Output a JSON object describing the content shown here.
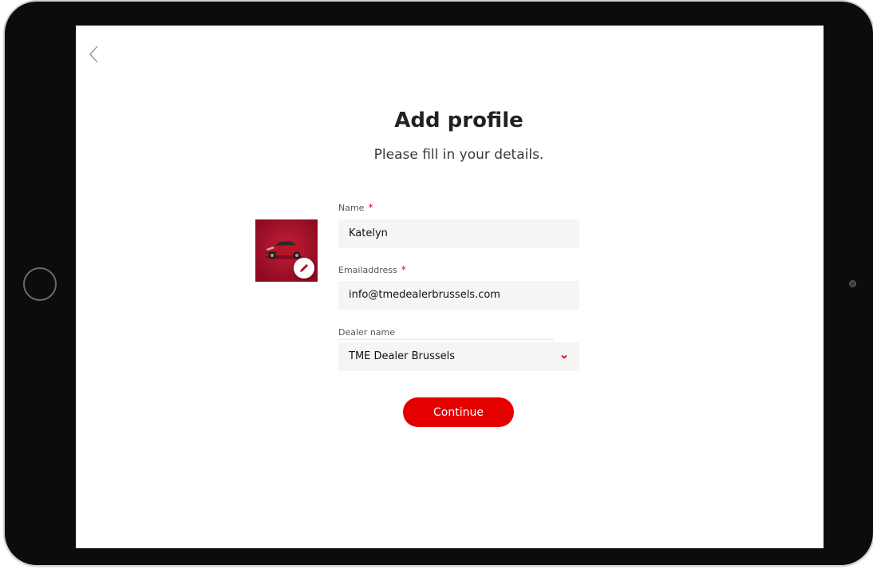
{
  "page": {
    "title": "Add profile",
    "subtitle": "Please fill in your details."
  },
  "form": {
    "name": {
      "label": "Name",
      "required_mark": "*",
      "value": "Katelyn"
    },
    "email": {
      "label": "Emailaddress",
      "required_mark": "*",
      "value": "info@tmedealerbrussels.com"
    },
    "dealer": {
      "label": "Dealer name",
      "selected": "TME Dealer Brussels"
    },
    "continue_label": "Continue"
  },
  "icons": {
    "back": "chevron-left-icon",
    "edit": "pencil-icon",
    "dropdown": "chevron-down-icon",
    "avatar": "car-image"
  },
  "colors": {
    "accent": "#e50000",
    "avatar_bg": "#a40f27",
    "field_bg": "#f5f5f5",
    "title": "#222222"
  }
}
